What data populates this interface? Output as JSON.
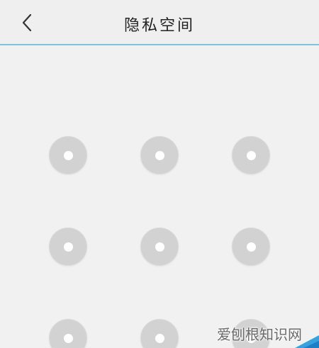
{
  "header": {
    "title": "隐私空间",
    "back_icon": "chevron-left-icon",
    "divider_color": "#7ec3de"
  },
  "pattern_lock": {
    "rows": 3,
    "columns": 3,
    "node_color": "#d2d2d2",
    "dot_color": "#ffffff"
  },
  "watermark": {
    "text": "爱刨根知识网"
  }
}
